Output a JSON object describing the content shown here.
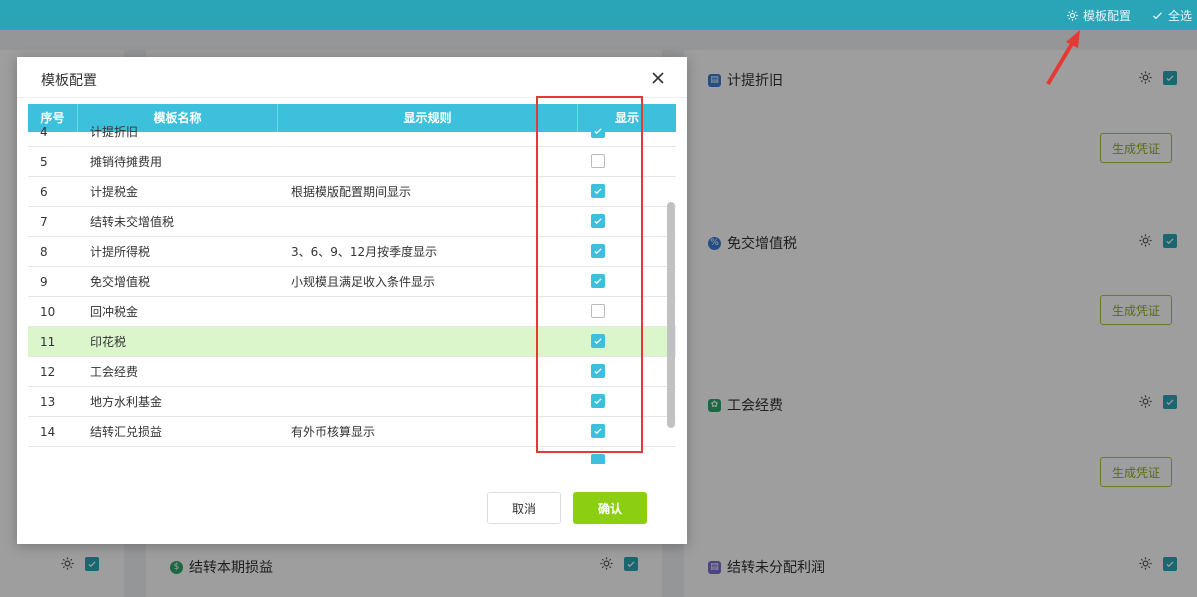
{
  "topbar": {
    "template_config_label": "模板配置",
    "select_all_label": "全选"
  },
  "background_cards": {
    "depreciation_title": "计提折旧",
    "vat_exempt_title": "免交增值税",
    "union_fee_title": "工会经费",
    "transfer_profit_title": "结转本期损益",
    "transfer_undistributed_title": "结转未分配利润",
    "generate_voucher_label": "生成凭证"
  },
  "modal": {
    "title": "模板配置",
    "columns": {
      "index": "序号",
      "name": "模板名称",
      "rule": "显示规则",
      "show": "显示"
    },
    "rows": [
      {
        "index": "4",
        "name": "计提折旧",
        "rule": "",
        "show": true,
        "highlight": false
      },
      {
        "index": "5",
        "name": "摊销待摊费用",
        "rule": "",
        "show": false,
        "highlight": false
      },
      {
        "index": "6",
        "name": "计提税金",
        "rule": "根据模版配置期间显示",
        "show": true,
        "highlight": false
      },
      {
        "index": "7",
        "name": "结转未交增值税",
        "rule": "",
        "show": true,
        "highlight": false
      },
      {
        "index": "8",
        "name": "计提所得税",
        "rule": "3、6、9、12月按季度显示",
        "show": true,
        "highlight": false
      },
      {
        "index": "9",
        "name": "免交增值税",
        "rule": "小规模且满足收入条件显示",
        "show": true,
        "highlight": false
      },
      {
        "index": "10",
        "name": "回冲税金",
        "rule": "",
        "show": false,
        "highlight": false
      },
      {
        "index": "11",
        "name": "印花税",
        "rule": "",
        "show": true,
        "highlight": true
      },
      {
        "index": "12",
        "name": "工会经费",
        "rule": "",
        "show": true,
        "highlight": false
      },
      {
        "index": "13",
        "name": "地方水利基金",
        "rule": "",
        "show": true,
        "highlight": false
      },
      {
        "index": "14",
        "name": "结转汇兑损益",
        "rule": "有外币核算显示",
        "show": true,
        "highlight": false
      }
    ],
    "cancel_label": "取消",
    "confirm_label": "确认"
  },
  "colors": {
    "topbar": "#2aa5b7",
    "table_header": "#3dc0db",
    "confirm_button": "#8ccf12",
    "highlight_row": "#dcf6cc",
    "annotation_red": "#e53935"
  },
  "icons": [
    "gear-icon",
    "check-icon",
    "close-icon",
    "checkbox-icon",
    "arrow-annotation"
  ]
}
